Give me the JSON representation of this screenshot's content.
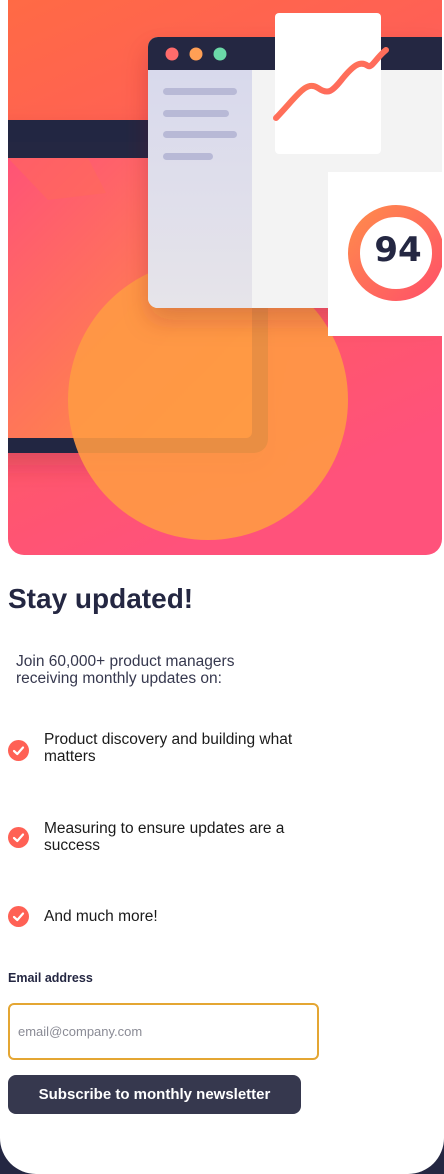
{
  "hero": {
    "score": "94",
    "window_dot_colors": [
      "#ff6b6b",
      "#ff9f55",
      "#6bd9a8"
    ]
  },
  "content": {
    "title": "Stay updated!",
    "intro": "Join 60,000+ product managers receiving monthly updates on:",
    "features": [
      {
        "text": "Product discovery and building what matters",
        "icon": "check-icon"
      },
      {
        "text": "Measuring to ensure updates are a success",
        "icon": "check-icon"
      },
      {
        "text": "And much more!",
        "icon": "check-icon"
      }
    ]
  },
  "form": {
    "email_label": "Email address",
    "email_placeholder": "email@company.com",
    "email_value": "",
    "submit_label": "Subscribe to monthly newsletter"
  },
  "colors": {
    "accent": "#ff6155",
    "dark_navy": "#242742",
    "charcoal": "#36384e",
    "input_border": "#e4a633"
  }
}
